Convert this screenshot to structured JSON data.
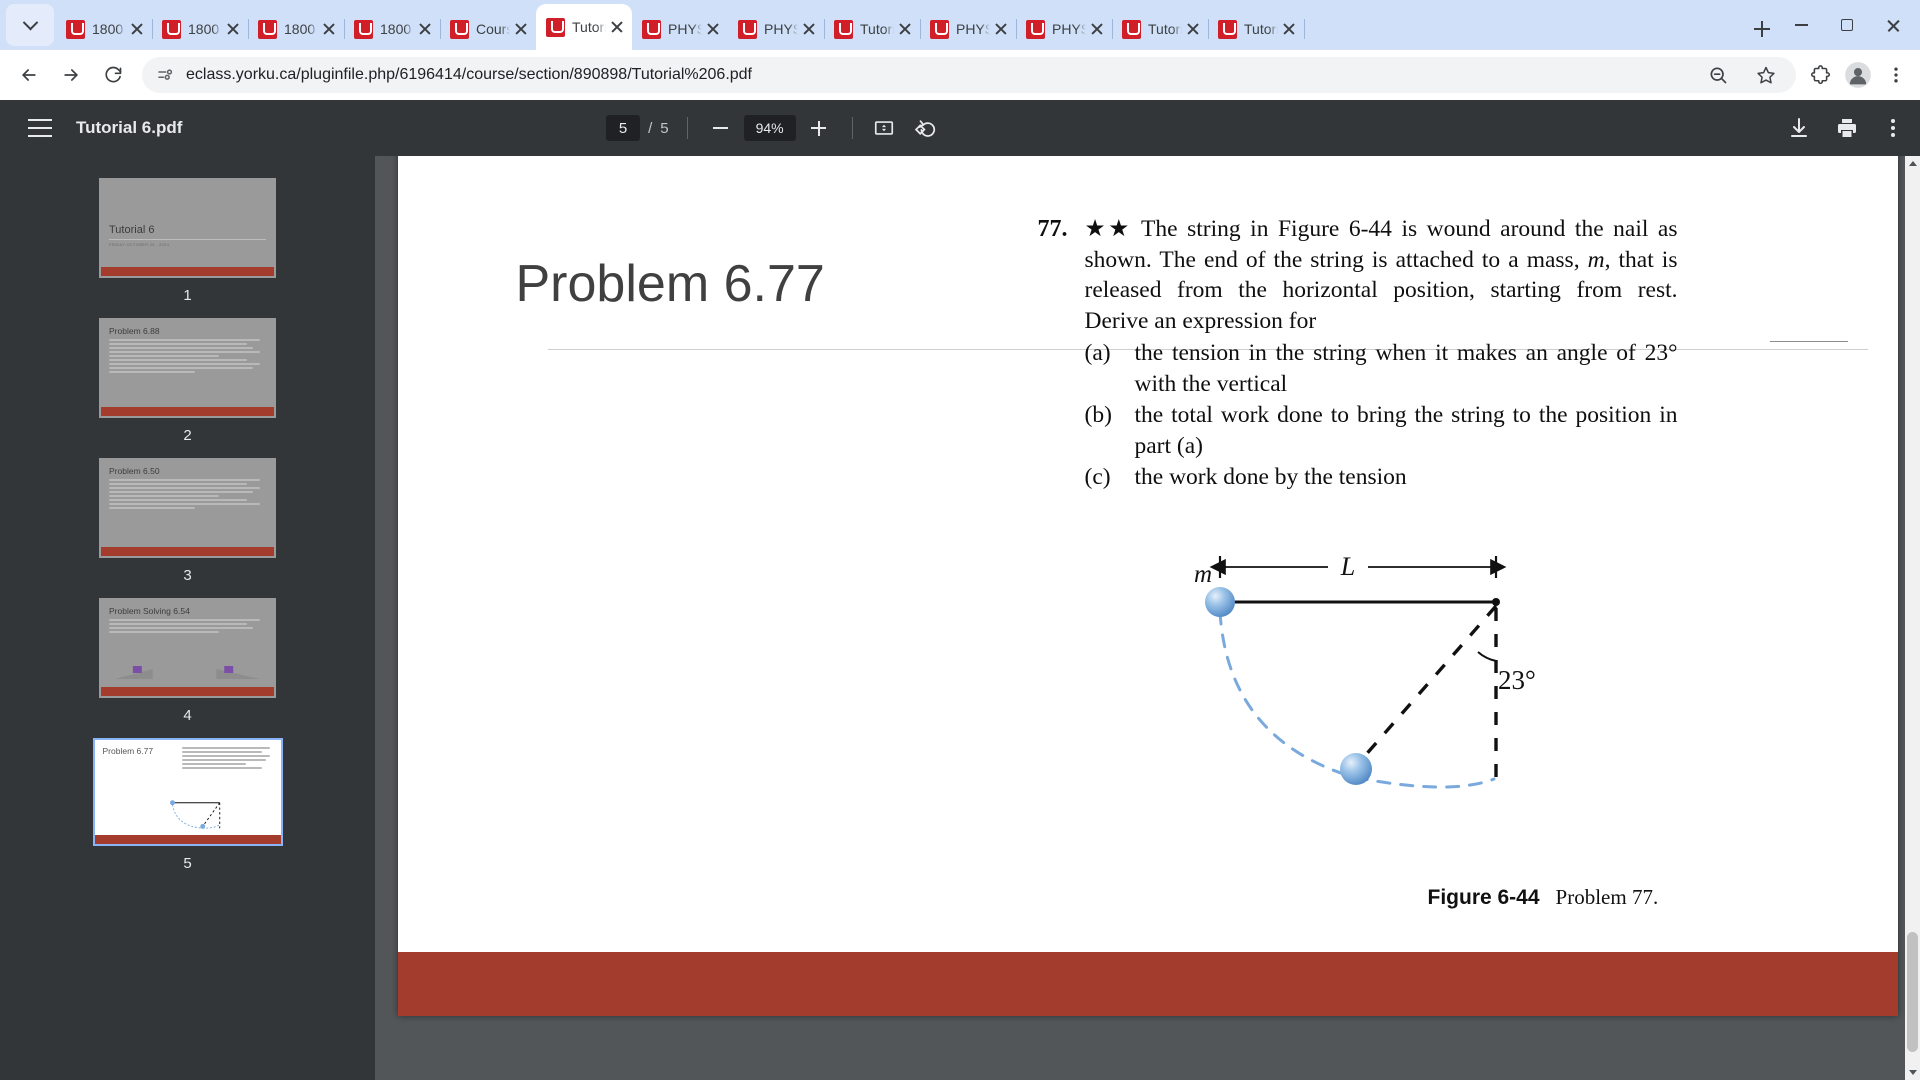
{
  "browser": {
    "tab_list_icon": "chevron-down-icon",
    "tabs": [
      {
        "title": "1800",
        "active": false
      },
      {
        "title": "1800",
        "active": false
      },
      {
        "title": "1800",
        "active": false
      },
      {
        "title": "1800",
        "active": false
      },
      {
        "title": "Cours",
        "active": false
      },
      {
        "title": "Tutori",
        "active": true
      },
      {
        "title": "PHYS",
        "active": false
      },
      {
        "title": "PHYS",
        "active": false
      },
      {
        "title": "Tutori",
        "active": false
      },
      {
        "title": "PHYS",
        "active": false
      },
      {
        "title": "PHYS",
        "active": false
      },
      {
        "title": "Tutori",
        "active": false
      },
      {
        "title": "Tutori",
        "active": false
      }
    ],
    "new_tab_label": "+",
    "window_controls": {
      "minimize": "minimize",
      "maximize": "maximize",
      "close": "close"
    },
    "nav": {
      "back": "back",
      "forward": "forward",
      "reload": "reload"
    },
    "omnibox": {
      "site_icon": "page-info-icon",
      "url": "eclass.yorku.ca/pluginfile.php/6196414/course/section/890898/Tutorial%206.pdf",
      "zoom_icon": "zoom-magnifier-icon",
      "bookmark_icon": "star-icon",
      "extensions_icon": "puzzle-icon",
      "profile_icon": "profile-avatar-icon",
      "menu_icon": "three-dot-menu-icon"
    }
  },
  "pdf_toolbar": {
    "menu_icon": "hamburger-menu-icon",
    "document_title": "Tutorial 6.pdf",
    "current_page": "5",
    "page_separator": "/",
    "total_pages": "5",
    "zoom_out_icon": "minus-icon",
    "zoom_level": "94%",
    "zoom_in_icon": "plus-icon",
    "fit_page_icon": "fit-to-page-icon",
    "rotate_icon": "rotate-icon",
    "download_icon": "download-icon",
    "print_icon": "print-icon",
    "more_icon": "kebab-menu-icon"
  },
  "thumbnails": [
    {
      "number": "1",
      "title": "Tutorial 6",
      "subtitle": "FRIDAY OCTOBER 25 , 2024",
      "active": false
    },
    {
      "number": "2",
      "title": "Problem 6.88",
      "subtitle": "",
      "active": false
    },
    {
      "number": "3",
      "title": "Problem 6.50",
      "subtitle": "",
      "active": false
    },
    {
      "number": "4",
      "title": "Problem Solving 6.54",
      "subtitle": "starting from rest",
      "active": false
    },
    {
      "number": "5",
      "title": "Problem 6.77",
      "subtitle": "",
      "active": true
    }
  ],
  "slide": {
    "title": "Problem 6.77",
    "problem": {
      "number": "77.",
      "stars": "★★",
      "intro": "The string in Figure 6-44 is wound around the nail as shown. The end of the string is attached to a mass, ",
      "intro_italic": "m",
      "intro_rest": ", that is released from the horizontal position, starting from rest. Derive an expression for",
      "parts": [
        {
          "label": "(a)",
          "text": "the tension in the string when it makes an angle of 23° with the vertical"
        },
        {
          "label": "(b)",
          "text": "the total work done to bring the string to the position in part (a)"
        },
        {
          "label": "(c)",
          "text": "the work done by the tension"
        }
      ]
    },
    "figure": {
      "mass_label": "m",
      "length_label": "L",
      "angle_label": "23°",
      "caption_number": "Figure 6-44",
      "caption_text": "Problem 77.",
      "string_color": "#000000",
      "path_color": "#7aa9dd",
      "ball_color": "#6fa8dc"
    }
  },
  "colors": {
    "tabstrip_bg": "#cfe0f8",
    "pdf_toolbar_bg": "#323639",
    "pdf_bg": "#525659",
    "slide_accent": "#a33c2d",
    "active_thumb_border": "#8ab4f8",
    "favicon": "#d11f2a"
  }
}
